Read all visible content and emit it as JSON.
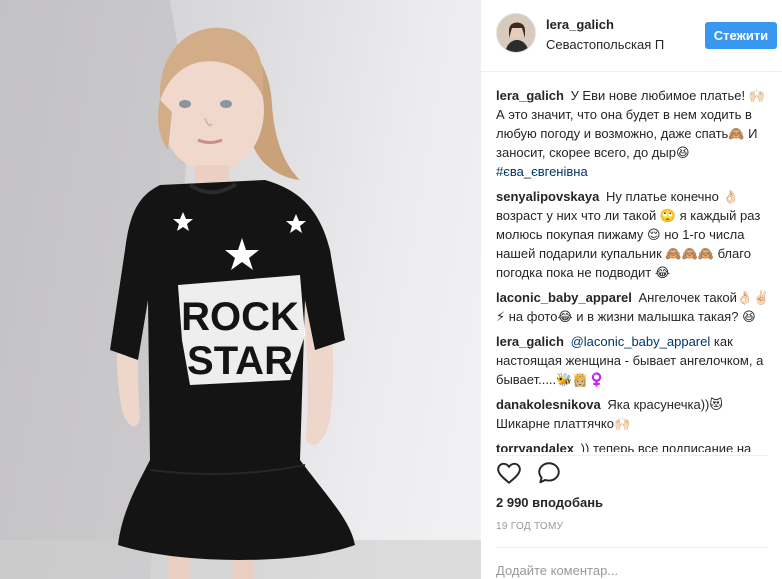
{
  "post": {
    "username": "lera_galich",
    "location": "Севастопольская Пл...",
    "follow_label": "Стежити",
    "likes": "2 990 вподобань",
    "time": "19 ГОД ТОМУ",
    "add_comment_placeholder": "Додайте коментар..."
  },
  "shirt": {
    "line1": "ROCK",
    "line2": "STAR"
  },
  "comments": [
    {
      "user": "lera_galich",
      "text": "У Еви нове любимое платье! 🙌🏻 А это значит, что она будет в нем ходить в любую погоду и возможно, даже спать🙈 И заносит, скорее всего, до дыр😆",
      "tag": "#єва_євгенівна"
    },
    {
      "user": "senyalipovskaya",
      "text": "Ну платье конечно 👌🏻 возраст у них что ли такой 🙄 я каждый раз молюсь покупая пижаму 😌 но 1-го числа нашей подарили купальник 🙈🙈🙈 благо погодка пока не подводит 😂"
    },
    {
      "user": "laconic_baby_apparel",
      "text": "Ангелочек такой👌🏻✌🏻⚡ на фото😂 и в жизни малышка такая? 😆"
    },
    {
      "user": "lera_galich",
      "mention": "@laconic_baby_apparel",
      "text": "как настоящая женщина - бывает ангелочком, а бывает.....🐝👸🏼♀️"
    },
    {
      "user": "danakolesnikova",
      "text": "Яка красунечка))😻 Шикарне платтячко🙌🏻"
    },
    {
      "user": "torryandalex",
      "text": ")) теперь все подписание на"
    }
  ],
  "icons": {
    "like": "heart-icon",
    "comment": "comment-icon"
  },
  "colors": {
    "accent": "#3897f0",
    "link": "#003569",
    "muted": "#999999"
  }
}
